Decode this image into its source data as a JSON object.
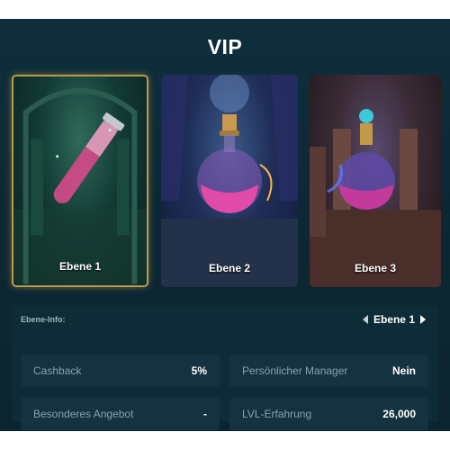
{
  "title": "VIP",
  "levels": [
    {
      "label": "Ebene 1"
    },
    {
      "label": "Ebene 2"
    },
    {
      "label": "Ebene 3"
    }
  ],
  "info": {
    "heading": "Ebene-Info:",
    "current_level": "Ebene 1",
    "stats": [
      {
        "label": "Cashback",
        "value": "5%"
      },
      {
        "label": "Persönlicher Manager",
        "value": "Nein"
      },
      {
        "label": "Besonderes Angebot",
        "value": "-"
      },
      {
        "label": "LVL-Erfahrung",
        "value": "26,000"
      }
    ]
  },
  "colors": {
    "accent_gold": "#b99a4c",
    "panel_bg": "#0f2e3b"
  },
  "icons": [
    "chevron-left-icon",
    "chevron-right-icon"
  ]
}
